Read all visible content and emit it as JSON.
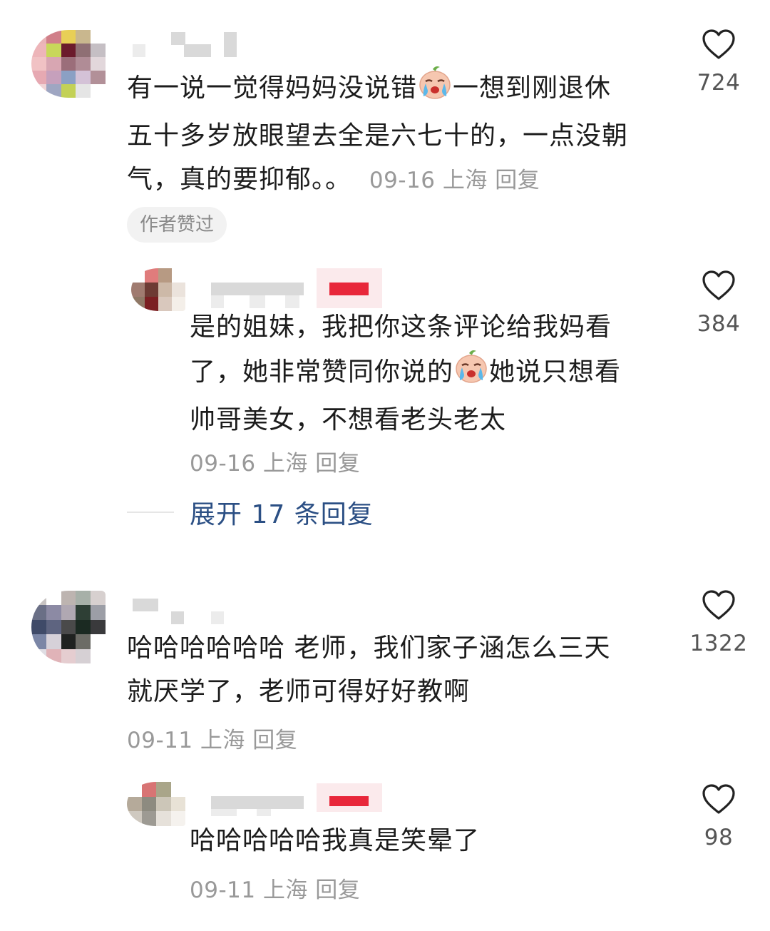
{
  "comments": [
    {
      "text_line1": "有一说一觉得妈妈没说错",
      "text_line1b": "一想到刚退休",
      "text_line2": "五十多岁放眼望去全是六七十的，一点没朝",
      "text_line3": "气，真的要抑郁。。",
      "meta": "09-16 上海 回复",
      "likes": "724",
      "tag": "作者赞过",
      "reply": {
        "text_line1": "是的姐妹，我把你这条评论给我妈看",
        "text_line2a": "了，她非常赞同你说的",
        "text_line2b": "她说只想看",
        "text_line3": "帅哥美女，不想看老头老太",
        "meta": "09-16 上海 回复",
        "likes": "384"
      },
      "expand_label": "展开 17 条回复"
    },
    {
      "text_line1": "哈哈哈哈哈哈 老师，我们家子涵怎么三天",
      "text_line2": "就厌学了，老师可得好好教啊",
      "meta": "09-11 上海 回复",
      "likes": "1322",
      "reply": {
        "text_line1": "哈哈哈哈哈我真是笑晕了",
        "meta": "09-11 上海 回复",
        "likes": "98"
      }
    }
  ],
  "icons": {
    "like": "heart-outline-icon",
    "emoji": "crying-face-emoji-icon"
  },
  "colors": {
    "link": "#2b4f84",
    "meta": "#999999",
    "badge_red": "#e8273a"
  }
}
